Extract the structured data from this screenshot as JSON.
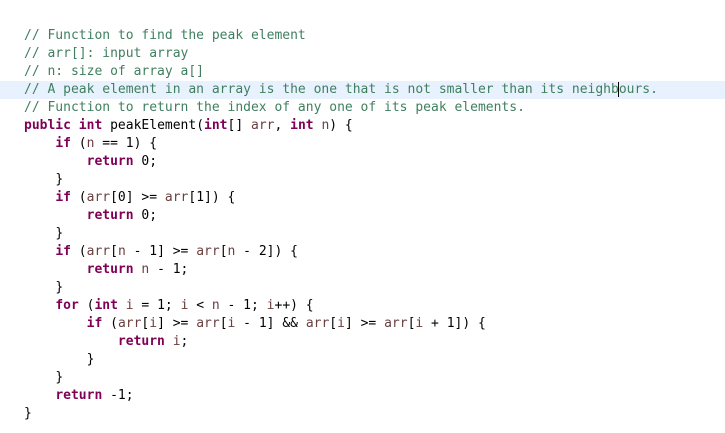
{
  "editor": {
    "lines": [
      {
        "indent": "",
        "parts": [
          {
            "t": "// Function to find the peak element",
            "c": "cmt"
          }
        ]
      },
      {
        "indent": "",
        "parts": [
          {
            "t": "// arr[]: input array",
            "c": "cmt"
          }
        ]
      },
      {
        "indent": "",
        "parts": [
          {
            "t": "// n: size of array a[]",
            "c": "cmt"
          }
        ]
      },
      {
        "indent": "",
        "current": true,
        "caret_after": "// A peak element in an array is the one that is not smaller than its neighb",
        "parts": [
          {
            "t": "// A peak element in an array is the one that is not smaller than its neighbours.",
            "c": "cmt"
          }
        ]
      },
      {
        "indent": "",
        "parts": [
          {
            "t": "// Function to return the index of any one of its peak elements.",
            "c": "cmt"
          }
        ]
      },
      {
        "indent": "",
        "parts": [
          {
            "t": "public",
            "c": "kw"
          },
          {
            "t": " "
          },
          {
            "t": "int",
            "c": "kw"
          },
          {
            "t": " peakElement("
          },
          {
            "t": "int",
            "c": "kw"
          },
          {
            "t": "[] "
          },
          {
            "t": "arr",
            "c": "var"
          },
          {
            "t": ", "
          },
          {
            "t": "int",
            "c": "kw"
          },
          {
            "t": " "
          },
          {
            "t": "n",
            "c": "var"
          },
          {
            "t": ") {"
          }
        ]
      },
      {
        "indent": "    ",
        "parts": [
          {
            "t": "if",
            "c": "kw"
          },
          {
            "t": " ("
          },
          {
            "t": "n",
            "c": "var"
          },
          {
            "t": " == 1) {"
          }
        ]
      },
      {
        "indent": "        ",
        "parts": [
          {
            "t": "return",
            "c": "kw"
          },
          {
            "t": " 0;"
          }
        ]
      },
      {
        "indent": "    ",
        "parts": [
          {
            "t": "}"
          }
        ]
      },
      {
        "indent": "    ",
        "parts": [
          {
            "t": "if",
            "c": "kw"
          },
          {
            "t": " ("
          },
          {
            "t": "arr",
            "c": "var"
          },
          {
            "t": "[0] >= "
          },
          {
            "t": "arr",
            "c": "var"
          },
          {
            "t": "[1]) {"
          }
        ]
      },
      {
        "indent": "        ",
        "parts": [
          {
            "t": "return",
            "c": "kw"
          },
          {
            "t": " 0;"
          }
        ]
      },
      {
        "indent": "    ",
        "parts": [
          {
            "t": "}"
          }
        ]
      },
      {
        "indent": "    ",
        "parts": [
          {
            "t": "if",
            "c": "kw"
          },
          {
            "t": " ("
          },
          {
            "t": "arr",
            "c": "var"
          },
          {
            "t": "["
          },
          {
            "t": "n",
            "c": "var"
          },
          {
            "t": " - 1] >= "
          },
          {
            "t": "arr",
            "c": "var"
          },
          {
            "t": "["
          },
          {
            "t": "n",
            "c": "var"
          },
          {
            "t": " - 2]) {"
          }
        ]
      },
      {
        "indent": "        ",
        "parts": [
          {
            "t": "return",
            "c": "kw"
          },
          {
            "t": " "
          },
          {
            "t": "n",
            "c": "var"
          },
          {
            "t": " - 1;"
          }
        ]
      },
      {
        "indent": "    ",
        "parts": [
          {
            "t": "}"
          }
        ]
      },
      {
        "indent": "    ",
        "parts": [
          {
            "t": "for",
            "c": "kw"
          },
          {
            "t": " ("
          },
          {
            "t": "int",
            "c": "kw"
          },
          {
            "t": " "
          },
          {
            "t": "i",
            "c": "var"
          },
          {
            "t": " = 1; "
          },
          {
            "t": "i",
            "c": "var"
          },
          {
            "t": " < "
          },
          {
            "t": "n",
            "c": "var"
          },
          {
            "t": " - 1; "
          },
          {
            "t": "i",
            "c": "var"
          },
          {
            "t": "++) {"
          }
        ]
      },
      {
        "indent": "        ",
        "parts": [
          {
            "t": "if",
            "c": "kw"
          },
          {
            "t": " ("
          },
          {
            "t": "arr",
            "c": "var"
          },
          {
            "t": "["
          },
          {
            "t": "i",
            "c": "var"
          },
          {
            "t": "] >= "
          },
          {
            "t": "arr",
            "c": "var"
          },
          {
            "t": "["
          },
          {
            "t": "i",
            "c": "var"
          },
          {
            "t": " - 1] && "
          },
          {
            "t": "arr",
            "c": "var"
          },
          {
            "t": "["
          },
          {
            "t": "i",
            "c": "var"
          },
          {
            "t": "] >= "
          },
          {
            "t": "arr",
            "c": "var"
          },
          {
            "t": "["
          },
          {
            "t": "i",
            "c": "var"
          },
          {
            "t": " + 1]) {"
          }
        ]
      },
      {
        "indent": "            ",
        "parts": [
          {
            "t": "return",
            "c": "kw"
          },
          {
            "t": " "
          },
          {
            "t": "i",
            "c": "var"
          },
          {
            "t": ";"
          }
        ]
      },
      {
        "indent": "        ",
        "parts": [
          {
            "t": "}"
          }
        ]
      },
      {
        "indent": "    ",
        "parts": [
          {
            "t": "}"
          }
        ]
      },
      {
        "indent": "    ",
        "parts": [
          {
            "t": "return",
            "c": "kw"
          },
          {
            "t": " -1;"
          }
        ]
      },
      {
        "indent": "",
        "parts": [
          {
            "t": "}"
          }
        ]
      }
    ]
  },
  "colors": {
    "comment": "#3f7f5f",
    "keyword": "#7f0055",
    "variable": "#6a3e3e",
    "current_line": "#e8f2fe"
  }
}
